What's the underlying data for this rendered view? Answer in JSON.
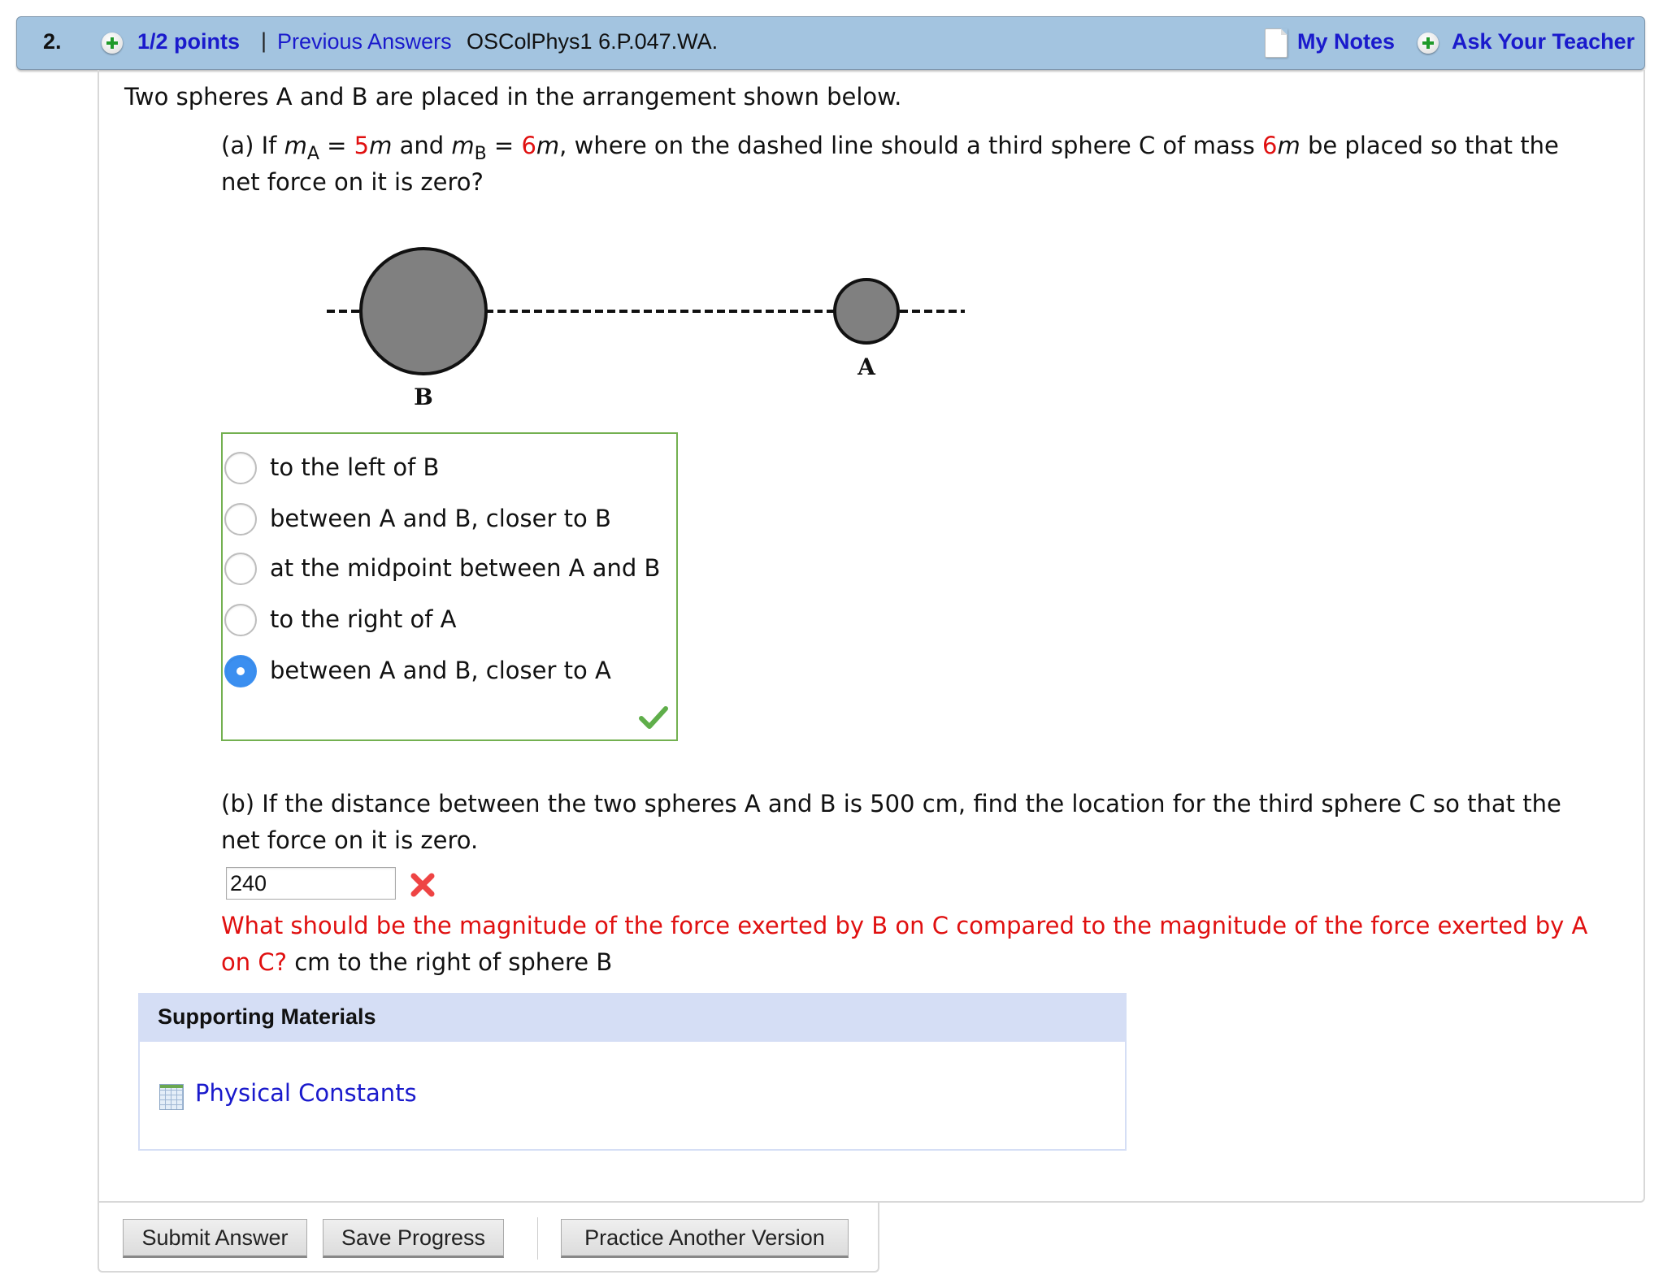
{
  "header": {
    "question_number": "2.",
    "points": "1/2 points",
    "separator": "|",
    "previous_answers": "Previous Answers",
    "problem_code": "OSColPhys1 6.P.047.WA.",
    "my_notes": "My Notes",
    "ask_teacher": "Ask Your Teacher"
  },
  "question": {
    "intro": "Two spheres A and B are placed in the arrangement shown below.",
    "part_a": {
      "prefix": "(a) If ",
      "mA_symbol": "m",
      "mA_sub": "A",
      "eq1": " = ",
      "mA_value": "5",
      "mA_unit": "m",
      "and": " and ",
      "mB_symbol": "m",
      "mB_sub": "B",
      "eq2": " = ",
      "mB_value": "6",
      "mB_unit": "m",
      "mid": ",  where on the dashed line should a third sphere C of mass ",
      "mC_value": "6",
      "mC_unit": "m",
      "suffix": " be placed so that the",
      "line2": "net force on it is zero?"
    },
    "diagram": {
      "label_B": "B",
      "label_A": "A"
    },
    "options": [
      {
        "label": "to the left of B",
        "selected": false
      },
      {
        "label": "between A and B, closer to B",
        "selected": false
      },
      {
        "label": "at the midpoint between A and B",
        "selected": false
      },
      {
        "label": "to the right of A",
        "selected": false
      },
      {
        "label": "between A and B, closer to A",
        "selected": true
      }
    ],
    "part_a_status": "correct",
    "part_b": {
      "line1": "(b) If the distance between the two spheres A and B is 500 cm, find the location for the third sphere C so that the",
      "line2": "net force on it is zero.",
      "answer_value": "240",
      "status": "incorrect",
      "hint_line1": "What should be the magnitude of the force exerted by B on C compared to the magnitude of the force exerted by A",
      "hint_line2_red": "on C?",
      "hint_line2_unit": " cm to the right of sphere B"
    }
  },
  "supporting_materials": {
    "title": "Supporting Materials",
    "links": [
      {
        "label": "Physical Constants",
        "icon": "table-icon"
      }
    ]
  },
  "buttons": {
    "submit": "Submit Answer",
    "save": "Save Progress",
    "practice": "Practice Another Version"
  },
  "colors": {
    "header_bg": "#a3c4e0",
    "link": "#1a1acc",
    "highlight_red": "#e01010",
    "correct_green": "#73b050",
    "radio_selected": "#3b8ff0",
    "support_header": "#d5def5"
  }
}
